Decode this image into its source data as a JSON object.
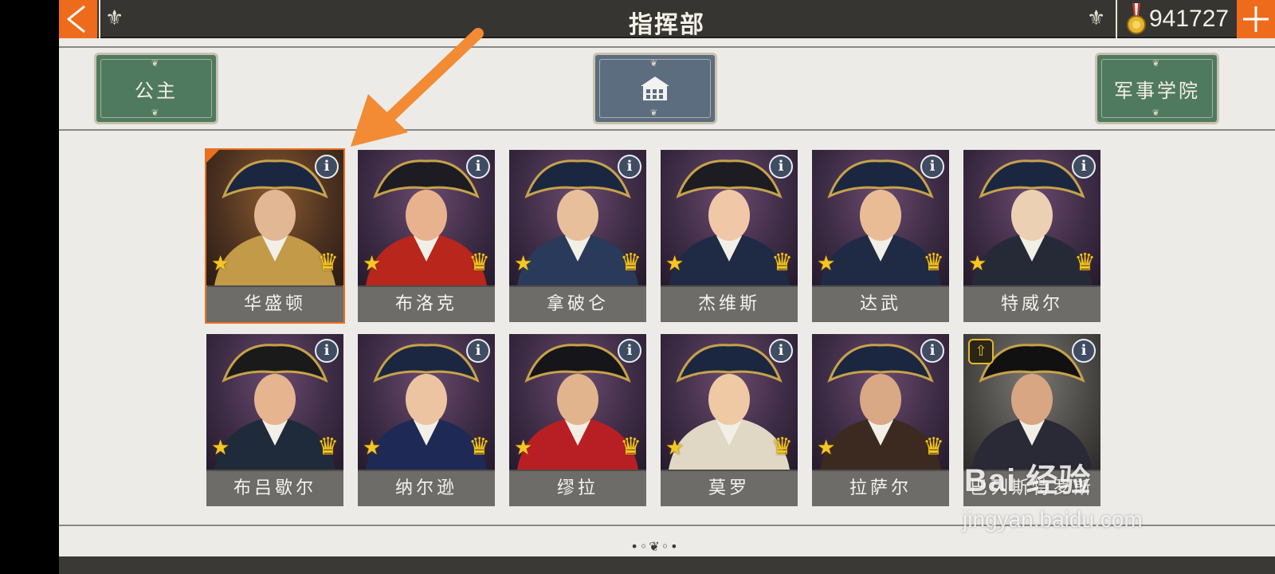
{
  "header": {
    "title": "指挥部",
    "coins": "941727",
    "back_icon": "back-arrow-icon",
    "add_icon": "plus-icon"
  },
  "buttons": {
    "left_label": "公主",
    "center_icon": "building-icon",
    "right_label": "军事学院"
  },
  "generals": [
    {
      "name": "华盛顿",
      "selected": true
    },
    {
      "name": "布洛克",
      "selected": false
    },
    {
      "name": "拿破仑",
      "selected": false
    },
    {
      "name": "杰维斯",
      "selected": false
    },
    {
      "name": "达武",
      "selected": false
    },
    {
      "name": "特威尔",
      "selected": false
    },
    {
      "name": "布吕歇尔",
      "selected": false
    },
    {
      "name": "纳尔逊",
      "selected": false
    },
    {
      "name": "缪拉",
      "selected": false
    },
    {
      "name": "莫罗",
      "selected": false
    },
    {
      "name": "拉萨尔",
      "selected": false
    },
    {
      "name": "巴列斯特罗斯",
      "selected": false
    }
  ],
  "watermark": {
    "logo": "Bai 经验",
    "url": "jingyan.baidu.com"
  },
  "colors": {
    "accent_orange": "#ef6b1c",
    "topbar": "#363532",
    "button_green": "#4f7a5f",
    "button_slate": "#5b6d7e",
    "star_gold": "#f5c625"
  }
}
